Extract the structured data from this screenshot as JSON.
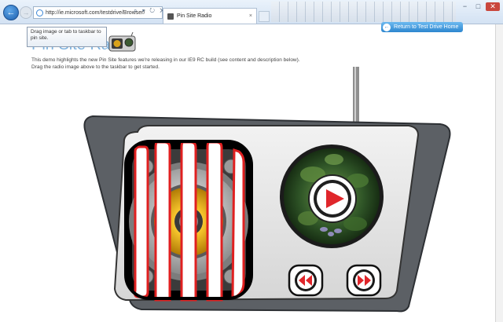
{
  "browser": {
    "url": "http://ie.microsoft.com/testdrive/Browser/",
    "tab_title": "Pin Site Radio",
    "tab_close": "×",
    "back_glyph": "←",
    "forward_glyph": "→",
    "address_tools": "⌕ ▾ ↻ ✕",
    "window_min": "−",
    "window_max": "□",
    "window_close": "✕"
  },
  "page": {
    "title": "Pin Site Radio",
    "return_button": "Return to Test Drive Home",
    "return_arrow": "←",
    "tooltip": "Drag image or tab to taskbar to pin site.",
    "description_line1": "This demo highlights the new Pin Site features we're releasing in our IE9 RC build (see content and description below).",
    "description_line2": "Drag the radio image above to the taskbar to get started."
  },
  "radio": {
    "play_state": "paused",
    "controls": [
      "play-icon",
      "rewind-icon",
      "fast-forward-icon"
    ]
  },
  "colors": {
    "accent_blue": "#2d86cf",
    "title_blue": "#7fb3df",
    "play_red": "#e0262b",
    "grill_red": "#e02020",
    "body_gray": "#e4e4e4",
    "back_panel": "#5a5e63"
  }
}
